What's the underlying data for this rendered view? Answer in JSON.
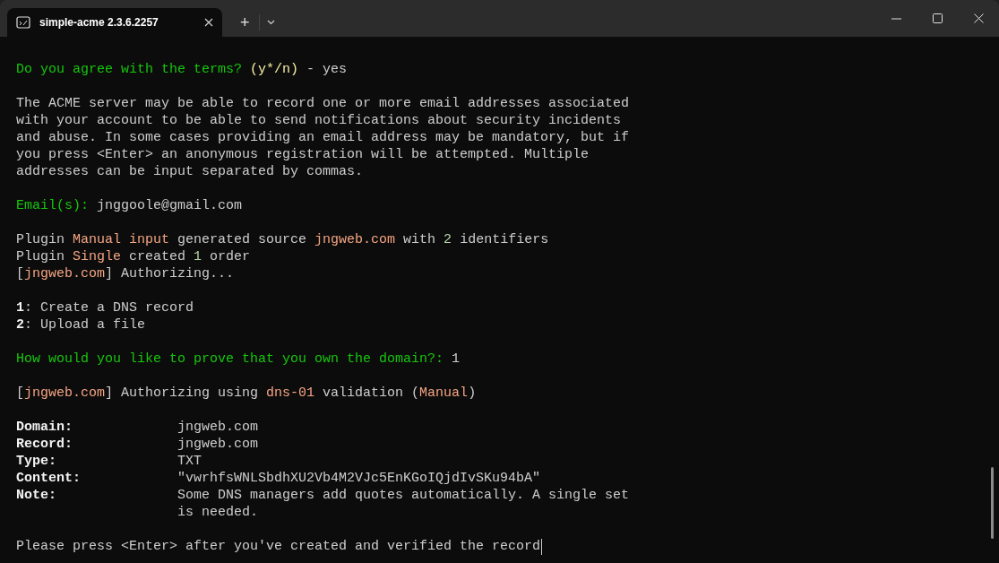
{
  "window": {
    "tab_title": "simple-acme 2.3.6.2257",
    "new_tab": "+"
  },
  "blocks": [
    [
      [
        {
          "text": "Do you agree with the terms? ",
          "kind": "prompt"
        },
        {
          "text": "(y*/n)",
          "kind": "hint"
        },
        {
          "text": " - yes",
          "kind": "plain"
        }
      ]
    ],
    [
      [
        {
          "text": "The ACME server may be able to record one or more email addresses associated",
          "kind": "plain"
        }
      ],
      [
        {
          "text": "with your account to be able to send notifications about security incidents",
          "kind": "plain"
        }
      ],
      [
        {
          "text": "and abuse. In some cases providing an email address may be mandatory, but if",
          "kind": "plain"
        }
      ],
      [
        {
          "text": "you press <Enter> an anonymous registration will be attempted. Multiple",
          "kind": "plain"
        }
      ],
      [
        {
          "text": "addresses can be input separated by commas.",
          "kind": "plain"
        }
      ]
    ],
    [
      [
        {
          "text": "Email(s): ",
          "kind": "prompt"
        },
        {
          "text": "jnggoole@gmail.com",
          "kind": "plain"
        }
      ]
    ],
    [
      [
        {
          "text": "Plugin ",
          "kind": "plain"
        },
        {
          "text": "Manual input",
          "kind": "accent"
        },
        {
          "text": " generated source ",
          "kind": "plain"
        },
        {
          "text": "jngweb.com",
          "kind": "accent"
        },
        {
          "text": " with ",
          "kind": "plain"
        },
        {
          "text": "2",
          "kind": "number"
        },
        {
          "text": " identifiers",
          "kind": "plain"
        }
      ],
      [
        {
          "text": "Plugin ",
          "kind": "plain"
        },
        {
          "text": "Single",
          "kind": "accent"
        },
        {
          "text": " created ",
          "kind": "plain"
        },
        {
          "text": "1",
          "kind": "number"
        },
        {
          "text": " order",
          "kind": "plain"
        }
      ],
      [
        {
          "text": "[",
          "kind": "plain"
        },
        {
          "text": "jngweb.com",
          "kind": "accent"
        },
        {
          "text": "] Authorizing...",
          "kind": "plain"
        }
      ]
    ],
    [
      [
        {
          "text": "1",
          "kind": "bold"
        },
        {
          "text": ": Create a DNS record",
          "kind": "plain"
        }
      ],
      [
        {
          "text": "2",
          "kind": "bold"
        },
        {
          "text": ": Upload a file",
          "kind": "plain"
        }
      ]
    ],
    [
      [
        {
          "text": "How would you like to prove that you own the domain?: ",
          "kind": "prompt"
        },
        {
          "text": "1",
          "kind": "plain"
        }
      ]
    ],
    [
      [
        {
          "text": "[",
          "kind": "plain"
        },
        {
          "text": "jngweb.com",
          "kind": "accent"
        },
        {
          "text": "] Authorizing using ",
          "kind": "plain"
        },
        {
          "text": "dns-01",
          "kind": "accent"
        },
        {
          "text": " validation (",
          "kind": "plain"
        },
        {
          "text": "Manual",
          "kind": "accent"
        },
        {
          "text": ")",
          "kind": "plain"
        }
      ]
    ]
  ],
  "record": [
    {
      "label": "Domain:",
      "value": "jngweb.com"
    },
    {
      "label": "Record:",
      "value": "jngweb.com"
    },
    {
      "label": "Type:",
      "value": "TXT"
    },
    {
      "label": "Content:",
      "value": "\"vwrhfsWNLSbdhXU2Vb4M2VJc5EnKGoIQjdIvSKu94bA\""
    },
    {
      "label": "Note:",
      "value": "Some DNS managers add quotes automatically. A single set is needed."
    }
  ],
  "final_prompt": "Please press <Enter> after you've created and verified the record"
}
